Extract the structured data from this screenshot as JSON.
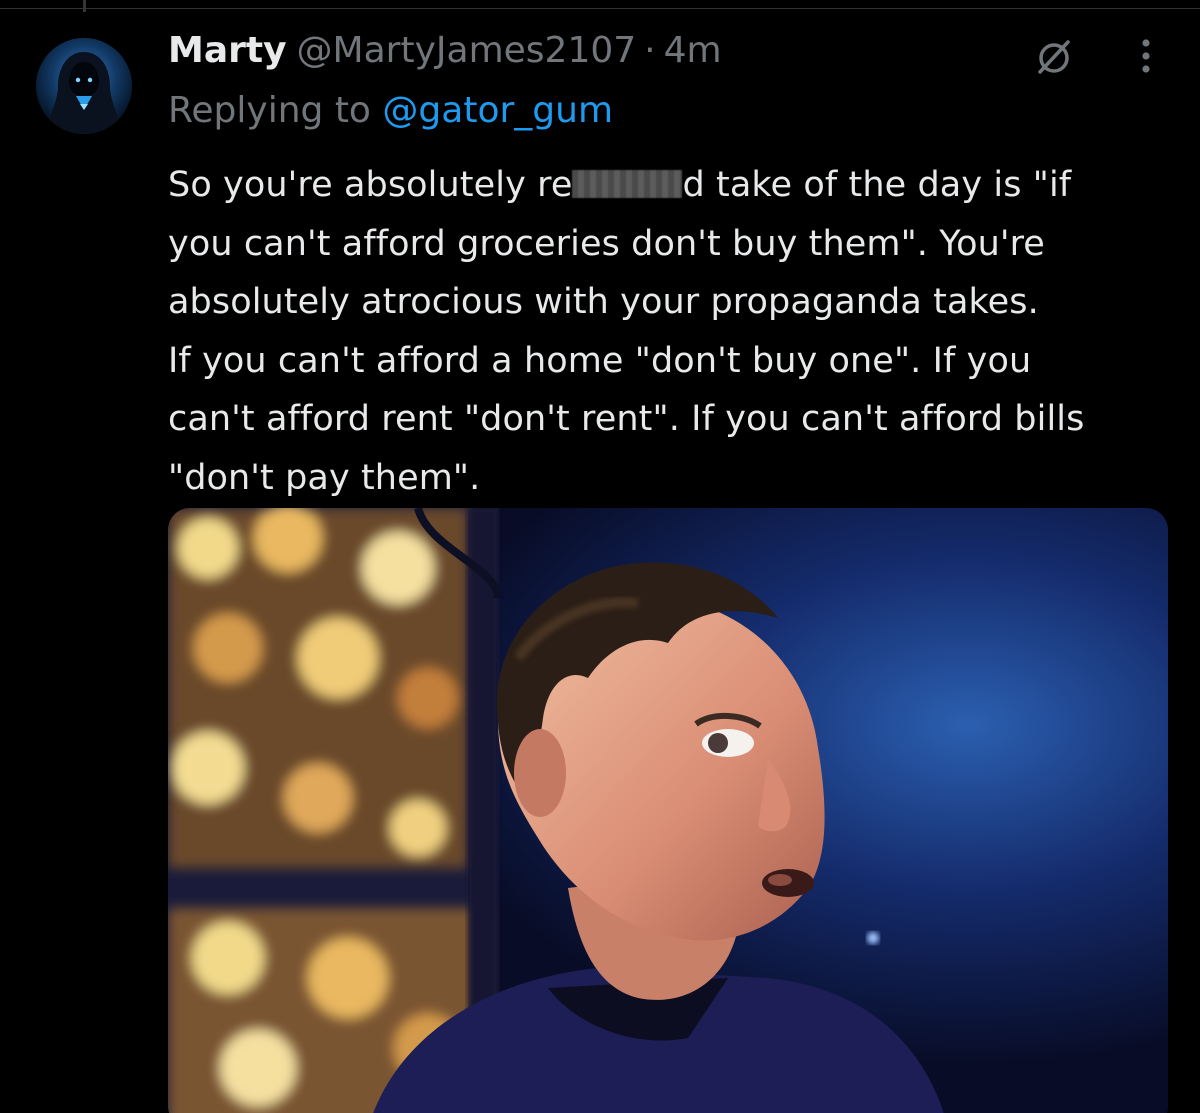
{
  "tweet": {
    "display_name": "Marty",
    "handle": "@MartyJames2107",
    "separator": "·",
    "timestamp": "4m",
    "replying_prefix": "Replying to",
    "replying_to": "@gator_gum",
    "text_lines": {
      "l1_start": "So you're absolutely re",
      "l1_end": "d take of the day is \"if",
      "l2": "you can't afford groceries don't buy them\". You're",
      "l3": "absolutely atrocious with your propaganda takes.",
      "l4": "If you can't afford a home \"don't buy one\". If you",
      "l5": "can't afford rent \"don't rent\". If you can't afford bills",
      "l6": "\"don't pay them\"."
    }
  },
  "icons": {
    "avatar": "hooded-figure-avatar",
    "no_icon": "circle-slash-icon",
    "more_icon": "vertical-ellipsis-icon"
  },
  "colors": {
    "background": "#000000",
    "primary_text": "#e7e9ea",
    "secondary_text": "#71767b",
    "accent": "#1d9bf0",
    "divider": "#2f3336"
  }
}
